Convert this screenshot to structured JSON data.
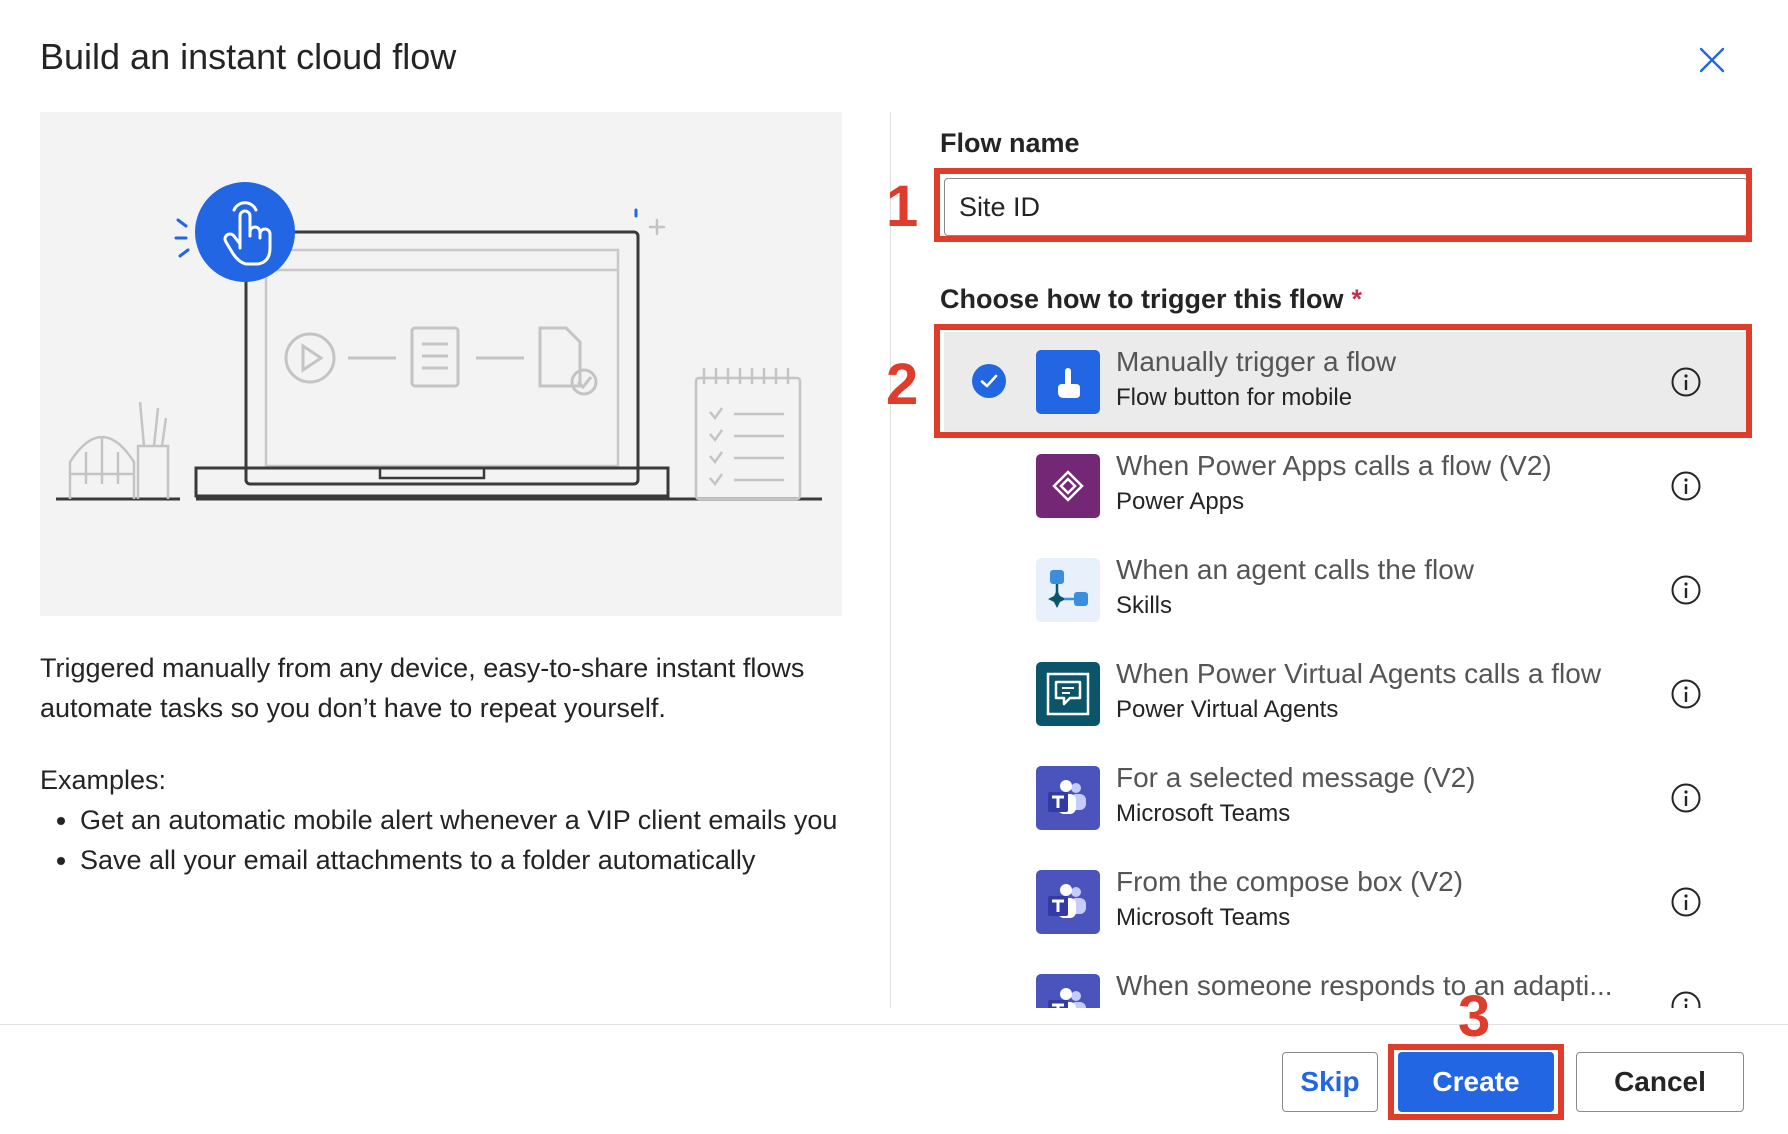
{
  "dialog": {
    "title": "Build an instant cloud flow",
    "description": "Triggered manually from any device, easy-to-share instant flows automate tasks so you don’t have to repeat yourself.",
    "examples_label": "Examples:",
    "examples": [
      "Get an automatic mobile alert whenever a VIP client emails you",
      "Save all your email attachments to a folder automatically"
    ]
  },
  "form": {
    "flow_name_label": "Flow name",
    "flow_name_value": "Site ID",
    "trigger_label": "Choose how to trigger this flow",
    "required_marker": "*"
  },
  "triggers": [
    {
      "title": "Manually trigger a flow",
      "subtitle": "Flow button for mobile",
      "icon": "touch-icon",
      "color": "#2266e3",
      "selected": true
    },
    {
      "title": "When Power Apps calls a flow (V2)",
      "subtitle": "Power Apps",
      "icon": "power-apps-icon",
      "color": "#742774",
      "selected": false
    },
    {
      "title": "When an agent calls the flow",
      "subtitle": "Skills",
      "icon": "skills-icon",
      "color": "#e8f1fb",
      "selected": false
    },
    {
      "title": "When Power Virtual Agents calls a flow",
      "subtitle": "Power Virtual Agents",
      "icon": "chat-bot-icon",
      "color": "#0b556a",
      "selected": false
    },
    {
      "title": "For a selected message (V2)",
      "subtitle": "Microsoft Teams",
      "icon": "teams-icon",
      "color": "#4b53bc",
      "selected": false
    },
    {
      "title": "From the compose box (V2)",
      "subtitle": "Microsoft Teams",
      "icon": "teams-icon",
      "color": "#4b53bc",
      "selected": false
    },
    {
      "title": "When someone responds to an adapti...",
      "subtitle": "",
      "icon": "teams-icon",
      "color": "#4b53bc",
      "selected": false
    }
  ],
  "buttons": {
    "skip": "Skip",
    "create": "Create",
    "cancel": "Cancel"
  },
  "annotations": {
    "one": "1",
    "two": "2",
    "three": "3",
    "color": "#e03c2c"
  },
  "colors": {
    "accent": "#2266e3"
  }
}
